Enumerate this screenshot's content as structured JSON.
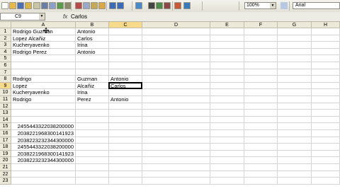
{
  "toolbar": {
    "zoom": "100%",
    "font": "Arial",
    "icons": [
      "new-icon",
      "open-icon",
      "save-icon",
      "permission-icon",
      "email-icon",
      "print-icon",
      "print-preview-icon",
      "spelling-icon",
      "research-icon",
      "cut-icon",
      "copy-icon",
      "paste-icon",
      "format-painter-icon",
      "undo-icon",
      "redo-icon",
      "hyperlink-icon",
      "autosum-icon",
      "sort-ascending-icon",
      "sort-descending-icon",
      "chart-wizard-icon",
      "drawing-icon"
    ]
  },
  "formula_bar": {
    "name_box": "C9",
    "fx": "fx",
    "value": "Carlos"
  },
  "columns": [
    "A",
    "B",
    "C",
    "D",
    "E",
    "F",
    "G",
    "H"
  ],
  "rows": [
    "1",
    "2",
    "3",
    "4",
    "5",
    "6",
    "7",
    "8",
    "9",
    "10",
    "11",
    "12",
    "13",
    "14",
    "15",
    "16",
    "17",
    "18",
    "19",
    "20",
    "21",
    "22",
    "23"
  ],
  "cells": {
    "A1": "Rodrigo Guzman",
    "B1": "Antonio",
    "A2": "Lopez Alcañiz",
    "B2": "Carlos",
    "A3": "Kucheryavenko",
    "B3": "Irina",
    "A4": "Rodrigo Perez",
    "B4": "Antonio",
    "A8": "Rodrigo",
    "B8": "Guzman",
    "C8": "Antonio",
    "A9": "Lopez",
    "B9": "Alcañiz",
    "C9": "Carlos",
    "A10": "Kucheryavenko",
    "B10": "Irina",
    "A11": "Rodrigo",
    "B11": "Perez",
    "C11": "Antonio",
    "A15": "2455443322038200000",
    "A16": "2038221968300141923",
    "A17": "2038223232344300000",
    "A18": "2455443322038200000",
    "A19": "2038221968300141923",
    "A20": "2038223232344300000"
  },
  "selection": "C9"
}
